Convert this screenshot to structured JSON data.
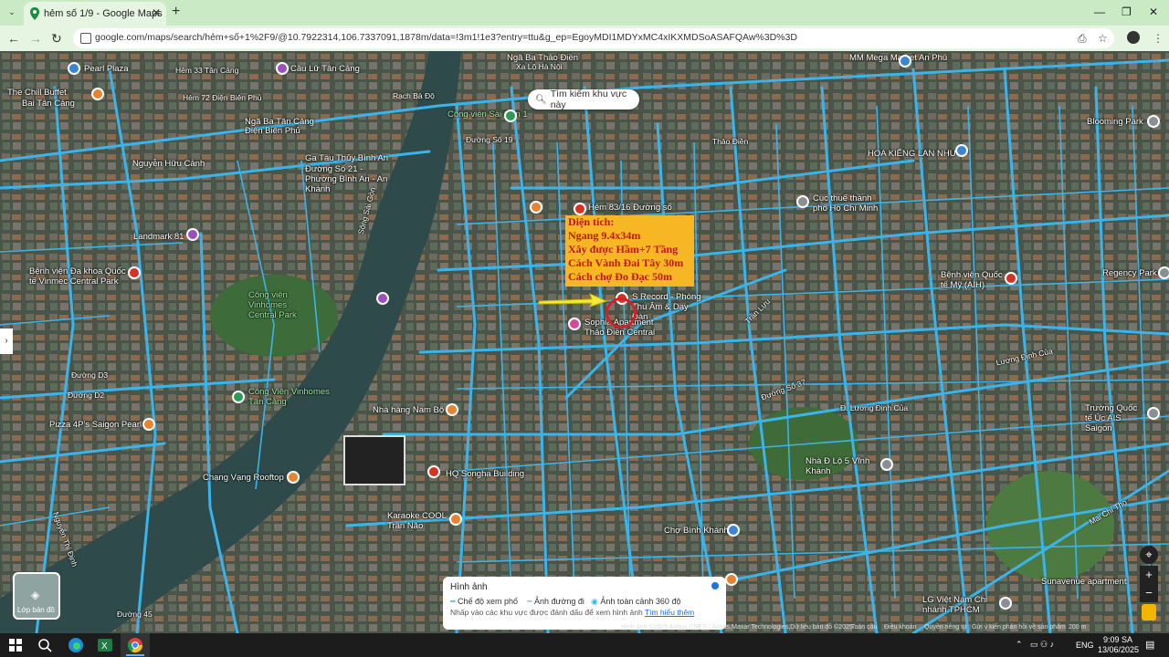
{
  "browser": {
    "tab_title": "hẻm số 1/9 - Google Maps",
    "url": "google.com/maps/search/hẻm+số+1%2F9/@10.7922314,106.7337091,1878m/data=!3m1!1e3?entry=ttu&g_ep=EgoyMDI1MDYxMC4xIKXMDSoASAFQAw%3D%3D"
  },
  "map": {
    "search_area_label": "Tìm kiếm khu vực này",
    "annotation": {
      "lines": [
        "Diện tích:",
        "Ngang 9.4x34m",
        "Xây được Hầm+7 Tầng",
        "Cách Vành Đai Tây 30m",
        "Cách chợ Đo Đạc 50m"
      ]
    },
    "places": [
      {
        "label": "Pearl Plaza",
        "kind": "building"
      },
      {
        "label": "Hẻm 33 Tân Cảng",
        "kind": "road"
      },
      {
        "label": "Cầu Lữ Tân Cảng",
        "kind": "poi"
      },
      {
        "label": "The Chill Buffet",
        "kind": "food"
      },
      {
        "label": "Bai Tân Cảng",
        "kind": "building"
      },
      {
        "label": "Hẻm 72 Điện Biên Phủ",
        "kind": "road"
      },
      {
        "label": "Rạch Bà Độ",
        "kind": "water"
      },
      {
        "label": "Ngã Ba Thảo Điền",
        "kind": "road"
      },
      {
        "label": "Xa Lộ Hà Nội",
        "kind": "road"
      },
      {
        "label": "MM Mega Market An Phú",
        "kind": "building"
      },
      {
        "label": "Ngã Ba Tân Cảng",
        "kind": "road"
      },
      {
        "label": "Điện Biên Phủ",
        "kind": "road"
      },
      {
        "label": "Công viên Sài Gòn 1",
        "kind": "park"
      },
      {
        "label": "Đường Số 19",
        "kind": "road"
      },
      {
        "label": "Blooming Park",
        "kind": "poi"
      },
      {
        "label": "Nguyễn Hữu Cảnh",
        "kind": "road"
      },
      {
        "label": "Ga Tàu Thủy Bình An",
        "kind": "poi"
      },
      {
        "label": "Đường Số 21 - Phường Bình An - An Khánh",
        "kind": "road"
      },
      {
        "label": "Thảo Điền",
        "kind": "road"
      },
      {
        "label": "HOA KIỂNG LAN NHƯ",
        "kind": "poi"
      },
      {
        "label": "Cục thuế thành phố Hồ Chí Minh",
        "kind": "building"
      },
      {
        "label": "Hẻm 83/16 Đường số",
        "kind": "road"
      },
      {
        "label": "Landmark 81",
        "kind": "building"
      },
      {
        "label": "Bệnh viện Đa khoa Quốc tế Vinmec Central Park",
        "kind": "hospital"
      },
      {
        "label": "Công viên Vinhomes Central Park",
        "kind": "park"
      },
      {
        "label": "Sông Sài Gòn",
        "kind": "water"
      },
      {
        "label": "S Record - Phòng Thu Âm & Dạy Đàn",
        "kind": "poi"
      },
      {
        "label": "Sophia Apartment Thảo Điền Central",
        "kind": "building"
      },
      {
        "label": "Bệnh viện Quốc tế Mỹ (AIH)",
        "kind": "hospital"
      },
      {
        "label": "Regency Park",
        "kind": "poi"
      },
      {
        "label": "Trần Lựu",
        "kind": "road"
      },
      {
        "label": "Đường Số 37",
        "kind": "road"
      },
      {
        "label": "Đường D3",
        "kind": "road"
      },
      {
        "label": "Đường D2",
        "kind": "road"
      },
      {
        "label": "Công Viên Vinhomes Tân Cảng",
        "kind": "park"
      },
      {
        "label": "Nhà hàng Nam Bộ",
        "kind": "food"
      },
      {
        "label": "Lương Định Của",
        "kind": "road"
      },
      {
        "label": "Trường Quốc tế Úc AIS Saigon",
        "kind": "school"
      },
      {
        "label": "Pizza 4P's Saigon Pearl",
        "kind": "food"
      },
      {
        "label": "Chạng Vạng Rooftop",
        "kind": "food"
      },
      {
        "label": "HQ Songha Building",
        "kind": "building"
      },
      {
        "label": "Nhà Đ Lộ 5 Vĩnh Khánh",
        "kind": "building"
      },
      {
        "label": "Karaoke COOL Trần Não",
        "kind": "poi"
      },
      {
        "label": "Chợ Bình Khánh",
        "kind": "poi"
      },
      {
        "label": "Sunavenue apartment",
        "kind": "building"
      },
      {
        "label": "LG Việt Nam Chi nhánh TPHCM",
        "kind": "building"
      },
      {
        "label": "Đường 45",
        "kind": "road"
      },
      {
        "label": "Mai Chí Thọ",
        "kind": "road"
      },
      {
        "label": "Nguyễn Thị Định",
        "kind": "road"
      },
      {
        "label": "Đ. Lương Định Của",
        "kind": "road"
      }
    ],
    "layers_button_label": "Lớp bản đồ",
    "legend": {
      "title": "Hình ảnh",
      "street_mode": "Chế độ xem phố",
      "route_photos": "Ảnh đường đi",
      "panorama": "Ảnh toàn cảnh 360 độ",
      "hint": "Nhấp vào các khu vực được đánh dấu để xem hình ảnh",
      "learn_more": "Tìm hiểu thêm"
    },
    "attribution": {
      "imagery": "Hình ảnh ©2025 Airbus,CNES / Airbus,Maxar Technologies,Dữ liệu bản đồ ©2025",
      "global": "Toàn cầu",
      "terms": "Điều khoản",
      "privacy": "Quyền riêng tư",
      "feedback": "Gửi ý kiến phản hồi về sản phẩm",
      "scale": "200 m"
    },
    "controls": {
      "zoom_in": "+",
      "zoom_out": "−"
    }
  },
  "taskbar": {
    "lang": "ENG",
    "time": "9:09 SA",
    "date": "13/06/2025"
  },
  "colors": {
    "street_overlay": "#3ab4ea",
    "annotation_bg": "#f7b623",
    "annotation_text": "#c0161c",
    "tab_strip": "#c9eac4"
  }
}
